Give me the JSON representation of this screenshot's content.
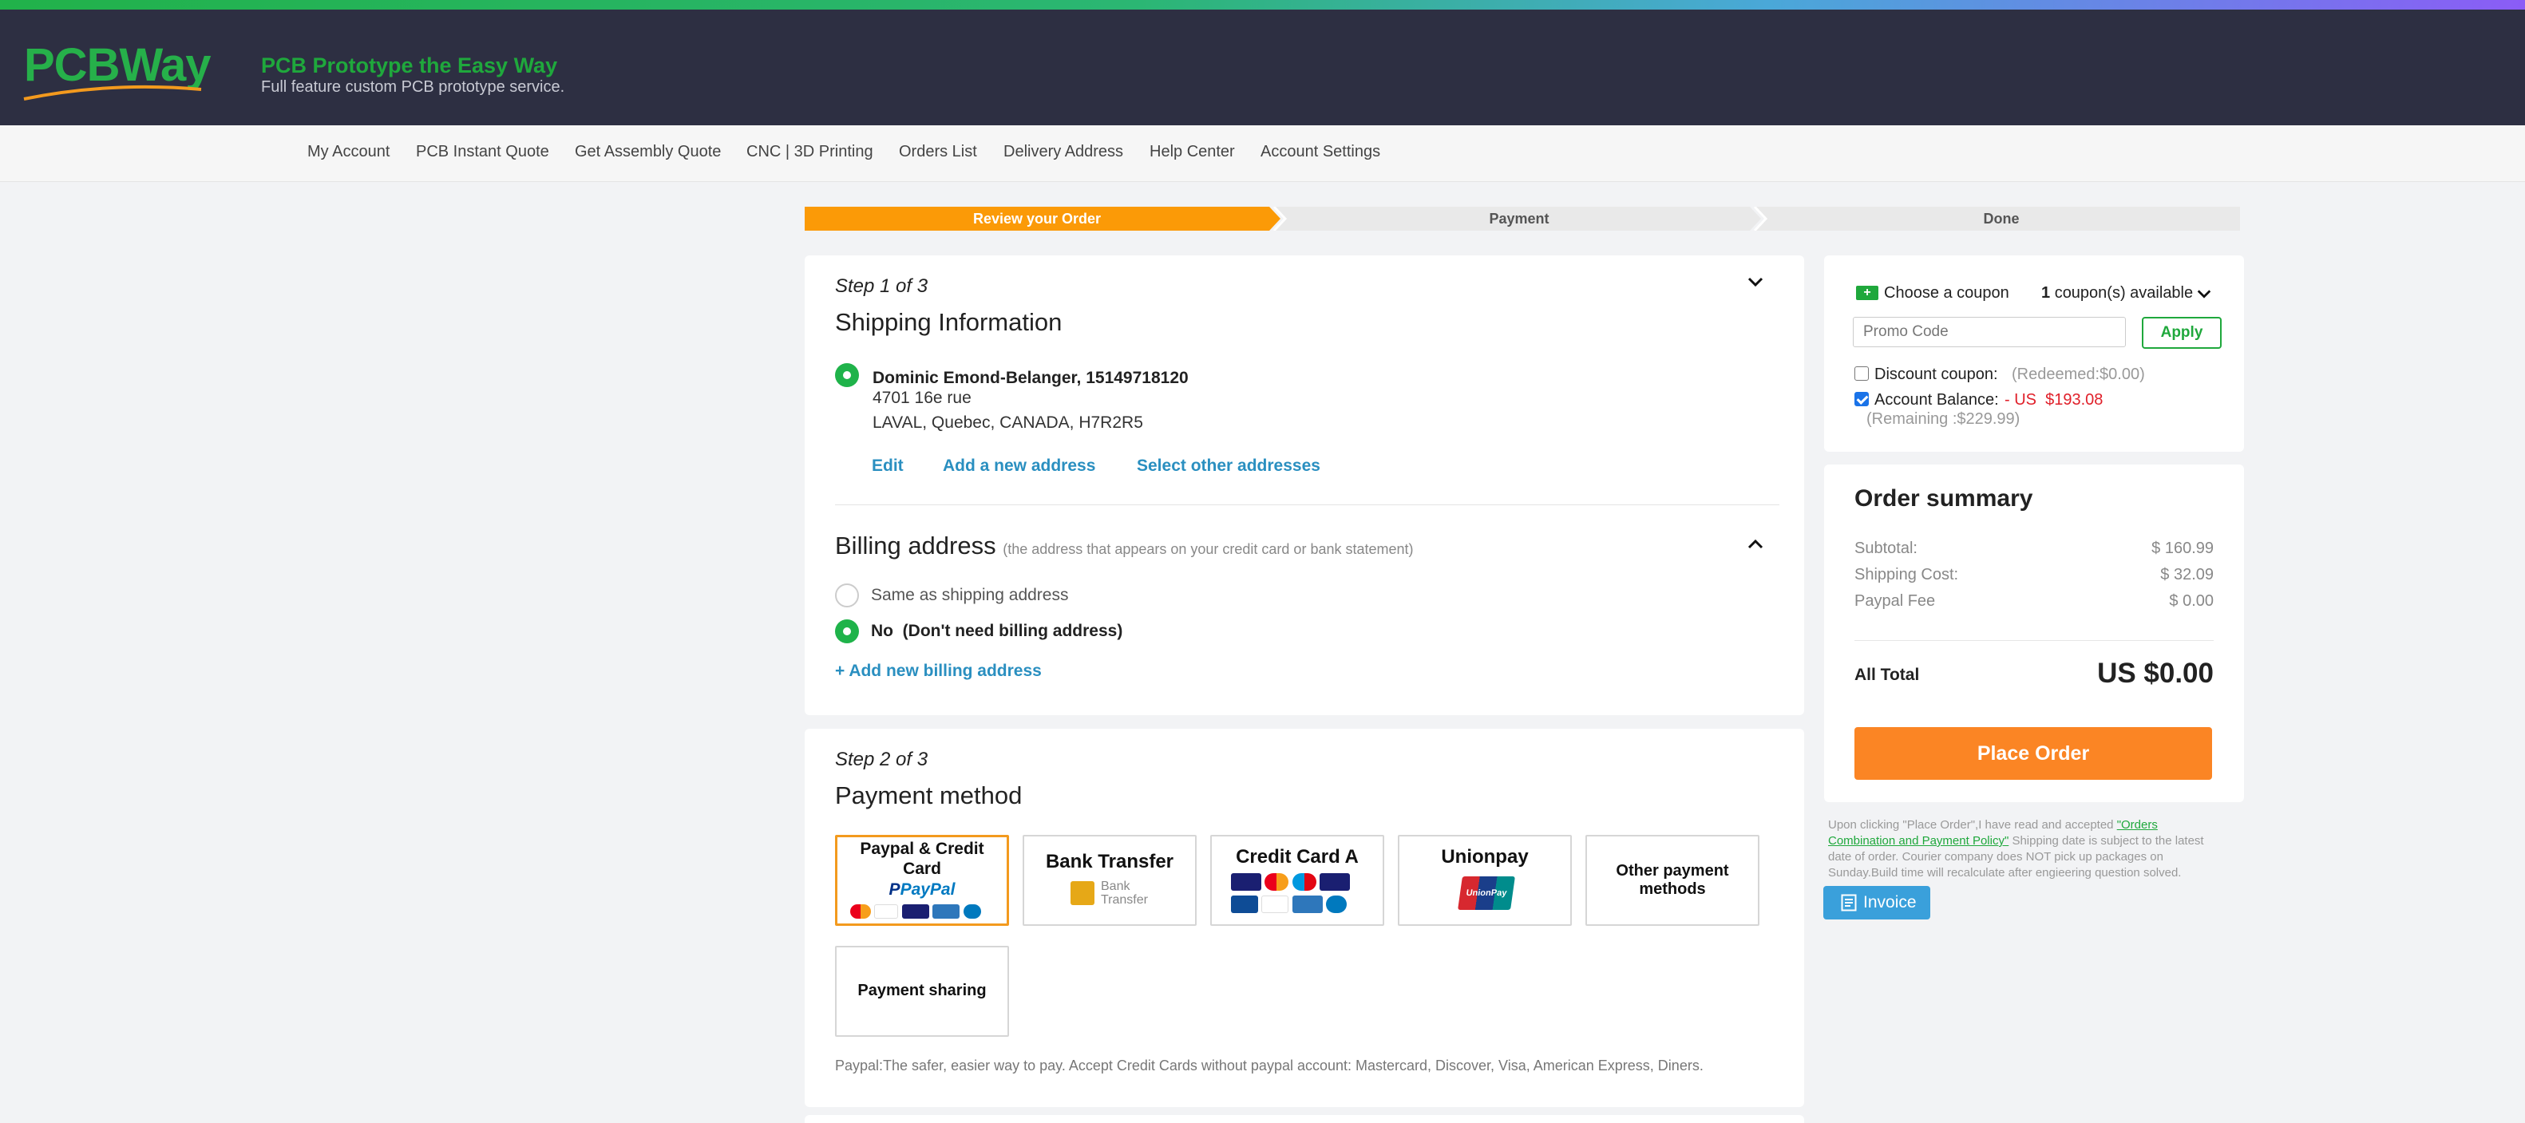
{
  "brand": {
    "logo_text": "PCBWay",
    "slogan_title": "PCB Prototype the Easy Way",
    "slogan_sub": "Full feature custom PCB prototype service."
  },
  "nav": [
    "My Account",
    "PCB Instant Quote",
    "Get Assembly Quote",
    "CNC | 3D Printing",
    "Orders List",
    "Delivery Address",
    "Help Center",
    "Account Settings"
  ],
  "progress": {
    "steps": [
      "Review your Order",
      "Payment",
      "Done"
    ],
    "active_step": "Review your Order"
  },
  "shipping": {
    "step_label": "Step 1 of 3",
    "title": "Shipping Information",
    "name_line": "Dominic Emond-Belanger, 15149718120",
    "address_line1": "4701 16e rue",
    "address_line2": "LAVAL, Quebec, CANADA, H7R2R5",
    "links": [
      "Edit",
      "Add a new address",
      "Select other addresses"
    ]
  },
  "billing": {
    "title": "Billing address",
    "note": "(the address that appears on your credit card or bank statement)",
    "option_same": "Same as shipping address",
    "option_no": "No  (Don't need billing address)",
    "selected_option": "No  (Don't need billing address)",
    "add_link": "+ Add new billing address"
  },
  "payment": {
    "step_label": "Step 2 of 3",
    "title": "Payment method",
    "methods": [
      {
        "label": "Paypal & Credit Card",
        "sub": "PayPal"
      },
      {
        "label": "Bank Transfer",
        "sub": "Bank Transfer"
      },
      {
        "label": "Credit Card A",
        "sub": ""
      },
      {
        "label": "Unionpay",
        "sub": "UnionPay"
      },
      {
        "label": "Other payment methods",
        "sub": ""
      },
      {
        "label": "Payment sharing",
        "sub": ""
      }
    ],
    "selected_method": "Paypal & Credit Card",
    "description": "Paypal:The safer, easier way to pay. Accept Credit Cards without paypal account: Mastercard, Discover, Visa, American Express, Diners."
  },
  "coupon": {
    "choose_label": "Choose a coupon",
    "available_count": "1",
    "available_suffix": "coupon(s) available",
    "promo_placeholder": "Promo Code",
    "apply_label": "Apply",
    "discount_label": "Discount coupon:",
    "discount_value": "(Redeemed:$0.00)",
    "discount_checked": false,
    "balance_label": "Account Balance:",
    "balance_value": "- US  $193.08",
    "balance_checked": true,
    "remaining": "(Remaining :$229.99)"
  },
  "summary": {
    "title": "Order summary",
    "rows": [
      {
        "label": "Subtotal:",
        "value": "$ 160.99"
      },
      {
        "label": "Shipping Cost:",
        "value": "$ 32.09"
      },
      {
        "label": "Paypal Fee",
        "value": "$ 0.00"
      }
    ],
    "total_label": "All Total",
    "total_value": "US $0.00",
    "place_order_label": "Place Order"
  },
  "notice": {
    "prefix": "Upon clicking \"Place Order\",I have read and accepted ",
    "link": "\"Orders Combination and Payment Policy\"",
    "suffix": " Shipping date is subject to the latest date of order. Courier company does NOT pick up packages on Sunday.Build time will recalculate after engieering question solved."
  },
  "invoice_label": "Invoice",
  "colors": {
    "brand_green": "#26b04a",
    "header_bg": "#2d2f42",
    "progress_active": "#fb9a07",
    "link_blue": "#2a8fc0",
    "place_order": "#fb8524",
    "radio_green": "#1fb34a",
    "invoice_blue": "#3aa0db"
  }
}
